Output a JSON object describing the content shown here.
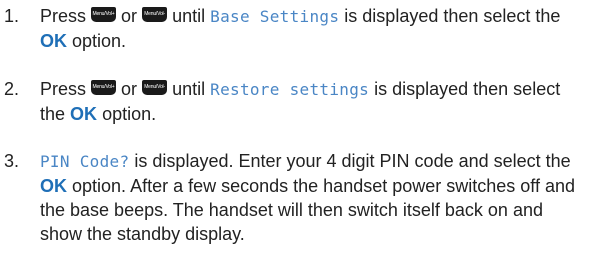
{
  "steps": [
    {
      "number": "1.",
      "press": "Press",
      "key_up": "Menu/Vol+",
      "or": "or",
      "key_down": "Menu/Vol-",
      "until": "until",
      "display": "Base Settings",
      "middle": "is displayed then select the",
      "ok": "OK",
      "end": "option."
    },
    {
      "number": "2.",
      "press": "Press",
      "key_up": "Menu/Vol+",
      "or": "or",
      "key_down": "Menu/Vol-",
      "until": "until",
      "display": "Restore settings",
      "middle": "is displayed then select the",
      "ok": "OK",
      "end": "option."
    },
    {
      "number": "3.",
      "display": "PIN Code?",
      "middle": "is displayed. Enter your 4 digit PIN code and select the",
      "ok": "OK",
      "end": "option. After a few seconds the handset power switches off and the base beeps. The handset will then switch itself back on and show the standby display."
    }
  ]
}
